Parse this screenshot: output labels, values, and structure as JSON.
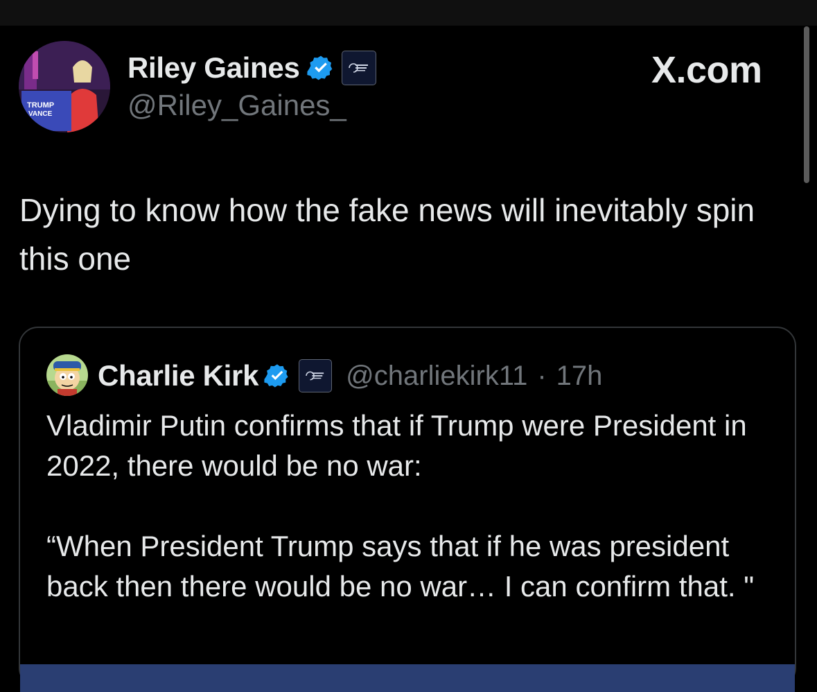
{
  "watermark": "X.com",
  "author": {
    "name": "Riley Gaines",
    "handle": "@Riley_Gaines_",
    "verified_icon": "verified-badge-icon",
    "affiliation_icon": "turning-point-usa-logo"
  },
  "tweet": {
    "text": "Dying to know how the fake news will inevitably spin this one"
  },
  "quoted": {
    "name": "Charlie Kirk",
    "handle": "@charliekirk11",
    "separator": "·",
    "time": "17h",
    "paragraph1": "Vladimir Putin confirms that if Trump were President in 2022, there would be no war:",
    "paragraph2": "“When President Trump says that if he was president back then there would be no war… I can confirm that. \""
  },
  "colors": {
    "background": "#000000",
    "text": "#e7e9ea",
    "secondary": "#71767b",
    "verified": "#1d9bf0",
    "border": "#333639"
  }
}
